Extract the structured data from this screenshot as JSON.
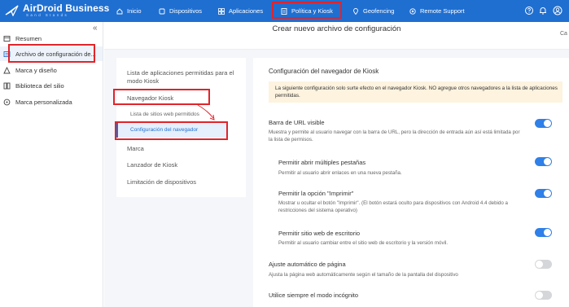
{
  "brand": {
    "name": "AirDroid Business",
    "sub": "Sand Stands"
  },
  "nav": {
    "items": [
      {
        "label": "Inicio",
        "icon": "home-icon"
      },
      {
        "label": "Dispositivos",
        "icon": "devices-icon"
      },
      {
        "label": "Aplicaciones",
        "icon": "apps-icon"
      },
      {
        "label": "Política y Kiosk",
        "icon": "policy-icon"
      },
      {
        "label": "Geofencing",
        "icon": "location-icon"
      },
      {
        "label": "Remote Support",
        "icon": "remote-support-icon"
      }
    ],
    "right_icons": [
      "help-icon",
      "bell-icon",
      "user-icon"
    ]
  },
  "sidebar": {
    "collapse_glyph": "«",
    "items": [
      {
        "label": "Resumen",
        "icon": "overview-icon"
      },
      {
        "label": "Archivo de configuración de...",
        "icon": "config-file-icon"
      },
      {
        "label": "Marca y diseño",
        "icon": "brand-design-icon"
      },
      {
        "label": "Biblioteca del silio",
        "icon": "library-icon"
      },
      {
        "label": "Marca personalizada",
        "icon": "custom-brand-icon"
      }
    ]
  },
  "page": {
    "title": "Crear nuevo archivo de configuración",
    "corner_text": "Ca"
  },
  "config_menu": {
    "items": [
      {
        "label": "Lista de aplicaciones permitidas para el modo Kiosk"
      },
      {
        "label": "Navegador Kiosk"
      },
      {
        "label": "Lista de sitios web permitidos"
      },
      {
        "label": "Configuración del navegador"
      },
      {
        "label": "Marca"
      },
      {
        "label": "Lanzador de Kiosk"
      },
      {
        "label": "Limitación de dispositivos"
      }
    ]
  },
  "panel": {
    "title": "Configuración del navegador de Kiosk",
    "notice": "La siguiente configuración solo surte efecto en el navegador Kiosk. NO agregue otros navegadores a la lista de aplicaciones permitidas.",
    "settings": [
      {
        "title": "Barra de URL visible",
        "desc": "Muestra y permite al usuario navegar con la barra de URL, pero la dirección de entrada aún así está limitada por la lista de permisos.",
        "on": true
      },
      {
        "title": "Permitir abrir múltiples pestañas",
        "desc": "Permitir al usuario abrir enlaces en una nueva pestaña.",
        "on": true
      },
      {
        "title": "Permitir la opción \"Imprimir\"",
        "desc": "Mostrar u ocultar el botón \"Imprimir\". (El botón estará oculto para dispositivos con Android 4.4 debido a restricciones del sistema operativo)",
        "on": true
      },
      {
        "title": "Permitir sitio web de escritorio",
        "desc": "Permitir al usuario cambiar entre el sitio web de escritorio y la versión móvil.",
        "on": true
      },
      {
        "title": "Ajuste automático de página",
        "desc": "Ajusta la página web automáticamente según el tamaño de la pantalla del dispositivo",
        "on": false
      },
      {
        "title": "Utilice siempre el modo incógnito",
        "desc": "",
        "on": false
      }
    ]
  },
  "colors": {
    "accent": "#1f6fd1",
    "highlight": "#e0242b",
    "toggle_on": "#2f80e8",
    "toggle_off": "#d4d6da",
    "notice_bg": "#fdf3df"
  }
}
